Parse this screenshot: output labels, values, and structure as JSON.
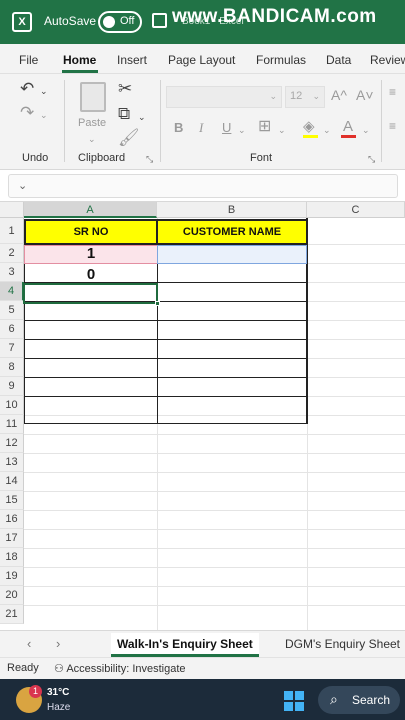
{
  "titlebar": {
    "logo": "X",
    "autosave_label": "AutoSave",
    "autosave_state": "Off",
    "doc_name": "Book1 - Excel",
    "watermark": "www.BANDICAM.com",
    "bg_color": "#217346"
  },
  "menu": {
    "items": [
      "File",
      "Home",
      "Insert",
      "Page Layout",
      "Formulas",
      "Data",
      "Review"
    ],
    "active": "Home"
  },
  "ribbon": {
    "groups": {
      "undo": "Undo",
      "clipboard": "Clipboard",
      "font": "Font"
    },
    "paste_label": "Paste",
    "font_size": "12",
    "icons": [
      "undo-icon",
      "redo-icon",
      "paste-icon",
      "cut-icon",
      "copy-icon",
      "format-painter-icon",
      "bold-icon",
      "italic-icon",
      "underline-icon",
      "borders-icon",
      "fill-color-icon",
      "font-color-icon",
      "increase-font-icon",
      "decrease-font-icon"
    ],
    "labels": {
      "bold": "B",
      "italic": "I",
      "underline": "U",
      "grow": "A^",
      "shrink": "A˅",
      "font_color": "A"
    }
  },
  "formula_bar": {
    "expand_icon": "chevron-down-icon",
    "glyph": "⌄"
  },
  "sheet": {
    "columns": [
      "A",
      "B",
      "C"
    ],
    "selected_column": "A",
    "rows": [
      "1",
      "2",
      "3",
      "4",
      "5",
      "6",
      "7",
      "8",
      "9",
      "10",
      "11",
      "12",
      "13",
      "14",
      "15",
      "16",
      "17",
      "18",
      "19",
      "20",
      "21"
    ],
    "selected_row": "4",
    "cells": {
      "A1": "SR NO",
      "B1": "CUSTOMER NAME",
      "A2": "1",
      "A3": "0"
    },
    "header_fill": "#ffff00"
  },
  "tabs": {
    "nav_prev": "‹",
    "nav_next": "›",
    "sheets": [
      "Walk-In's Enquiry Sheet",
      "DGM's Enquiry Sheet"
    ],
    "active": "Walk-In's Enquiry Sheet"
  },
  "status": {
    "ready": "Ready",
    "accessibility": "Accessibility: Investigate"
  },
  "taskbar": {
    "badge": "1",
    "temperature": "31°C",
    "condition": "Haze",
    "search_label": "Search"
  }
}
